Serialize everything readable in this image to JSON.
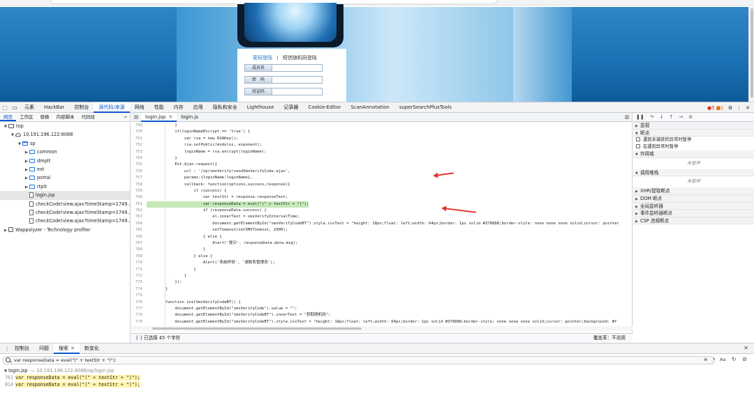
{
  "page": {
    "login_tab_password": "密码登陆",
    "login_sep": "|",
    "login_tab_sms": "短信随机码登陆",
    "field_user": "成员名",
    "field_password": "密　码",
    "field_captcha": "验证码"
  },
  "devtools": {
    "tabs": [
      "元素",
      "HackBar",
      "控制台",
      "源代码/来源",
      "网络",
      "性能",
      "内存",
      "应用",
      "隐私和安全",
      "Lighthouse",
      "记录器",
      "Cookie-Editor",
      "ScanAnnotation",
      "superSearchPlusTools"
    ],
    "active_tab": 3,
    "errors": "5",
    "warnings": "1"
  },
  "navigator": {
    "tabs": [
      "网页",
      "工作区",
      "替换",
      "内容脚本",
      "代码段"
    ],
    "active_tab": 0,
    "tree": [
      {
        "depth": 0,
        "tw": "▼",
        "icon": "frame",
        "label": "top"
      },
      {
        "depth": 1,
        "tw": "▼",
        "icon": "cloud",
        "label": "10.191.196.122:8088"
      },
      {
        "depth": 2,
        "tw": "▼",
        "icon": "folder-open",
        "label": "sp"
      },
      {
        "depth": 3,
        "tw": "▶",
        "icon": "folder",
        "label": "common"
      },
      {
        "depth": 3,
        "tw": "▶",
        "icon": "folder",
        "label": "dmplt"
      },
      {
        "depth": 3,
        "tw": "▶",
        "icon": "folder",
        "label": "ext"
      },
      {
        "depth": 3,
        "tw": "▶",
        "icon": "folder",
        "label": "portal"
      },
      {
        "depth": 3,
        "tw": "▶",
        "icon": "folder",
        "label": "rtplt"
      },
      {
        "depth": 3,
        "tw": "",
        "icon": "file",
        "label": "login.jsp",
        "selected": true
      },
      {
        "depth": 3,
        "tw": "",
        "icon": "file",
        "label": "checkCode!view.ajax?timeStamp=1749..."
      },
      {
        "depth": 3,
        "tw": "",
        "icon": "file",
        "label": "checkCode!view.ajax?timeStamp=1749..."
      },
      {
        "depth": 3,
        "tw": "",
        "icon": "file",
        "label": "checkCode!view.ajax?timeStamp=1749..."
      },
      {
        "depth": 0,
        "tw": "▶",
        "icon": "ext",
        "label": "Wappalyzer - Technology profiler"
      }
    ]
  },
  "editor": {
    "tabs": [
      {
        "label": "login.jsp",
        "active": true,
        "closable": true
      },
      {
        "label": "login.js",
        "active": false,
        "closable": false
      }
    ],
    "lines": [
      {
        "n": "749",
        "t": "            }"
      },
      {
        "n": "750",
        "t": "            if(loginNameEncrypt == 'true') {"
      },
      {
        "n": "751",
        "t": "                var rsa = new RSAKey();"
      },
      {
        "n": "752",
        "t": "                rsa.setPublic(modulus, exponent);"
      },
      {
        "n": "753",
        "t": "                loginName = rsa.encrypt(loginName);"
      },
      {
        "n": "754",
        "t": "            }"
      },
      {
        "n": "755",
        "t": "            Ext.Ajax.request({"
      },
      {
        "n": "756",
        "t": "                url : '/sp/smsVerify!sendSmsVerifyCode.ajax',"
      },
      {
        "n": "757",
        "t": "                params:{loginName:loginName},"
      },
      {
        "n": "758",
        "t": "                callback: function(options,success,response){"
      },
      {
        "n": "759",
        "t": "                    if (success) {"
      },
      {
        "n": "760",
        "t": "                        var textStr = response.responseText;"
      },
      {
        "n": "761",
        "t": "                        var responseData = eval(\"(\" + textStr + \")\");",
        "hl": true
      },
      {
        "n": "762",
        "t": "                        if (responseData.success) {"
      },
      {
        "n": "763",
        "t": "                            el.innerText = smsVerifyIntervalTime;"
      },
      {
        "n": "764",
        "t": "                            document.getElementById(\"smsVerifyCodeBT\").style.cssText = \"height: 18px;float: left;width: 64px;border: 1px solid #378888;border-style: none none none solid;cursor: pointer"
      },
      {
        "n": "765",
        "t": "                            setTimeout(setSMSTimeout, 1000);"
      },
      {
        "n": "766",
        "t": "                        } else {"
      },
      {
        "n": "767",
        "t": "                            Alert('提示', responseData.data.msg);"
      },
      {
        "n": "768",
        "t": "                        }"
      },
      {
        "n": "769",
        "t": "                    } else {"
      },
      {
        "n": "770",
        "t": "                        Alert('系统异常', '请联系管理员');"
      },
      {
        "n": "771",
        "t": "                    }"
      },
      {
        "n": "772",
        "t": "                }"
      },
      {
        "n": "773",
        "t": "            });"
      },
      {
        "n": "774",
        "t": "        }"
      },
      {
        "n": "775",
        "t": ""
      },
      {
        "n": "776",
        "t": "        function initSmsVerifyCodeBT() {"
      },
      {
        "n": "777",
        "t": "            document.getElementById(\"smsVerifyCode\").value = \"\";"
      },
      {
        "n": "778",
        "t": "            document.getElementById(\"smsVerifyCodeBT\").innerText = \"获取随机码\";"
      },
      {
        "n": "779",
        "t": "            document.getElementById(\"smsVerifyCodeBT\").style.cssText = \"height: 18px;float: left;width: 64px;border: 1px solid #378888;border-style: none none none solid;cursor: pointer;background: #f"
      }
    ],
    "status_braces": "{ }",
    "status_selection": "已选择 45 个字符",
    "status_coverage": "覆盖率：不适用"
  },
  "debugger": {
    "watch": "监视",
    "breakpoints": "断点",
    "bp_uncaught": "遇到未捕获的异常时暂停",
    "bp_caught": "在遇到异常时暂停",
    "scope": "作用域",
    "not_paused_1": "未暂停",
    "callstack": "调用堆栈",
    "not_paused_2": "未暂停",
    "xhr": "XHR/提取断点",
    "dom": "DOM 断点",
    "global": "全局监听器",
    "event": "事件监听器断点",
    "csp": "CSP 违规断点"
  },
  "drawer": {
    "tabs": [
      {
        "label": "控制台",
        "active": false,
        "closable": false
      },
      {
        "label": "问题",
        "active": false,
        "closable": false
      },
      {
        "label": "搜索",
        "active": true,
        "closable": true
      },
      {
        "label": "新变化",
        "active": false,
        "closable": false
      }
    ],
    "search_value": "var responseData = eval(\"(\" + textStr + \")\");",
    "opt_case": "Aa",
    "opt_regex": ".*",
    "result_file": "login.jsp",
    "result_path": "— 10.191.196.122:8088/sp/login.jsp",
    "results": [
      {
        "n": "761",
        "t": "var responseData = eval(\"(\" + textStr + \")\");"
      },
      {
        "n": "814",
        "t": "var responseData = eval(\"(\" + textStr + \")\");"
      }
    ]
  },
  "colors": {
    "accent": "#0b57d0",
    "code_highlight": "#c5e8b7",
    "search_highlight": "#fff3a8",
    "annotation_arrow": "#e8302a"
  }
}
